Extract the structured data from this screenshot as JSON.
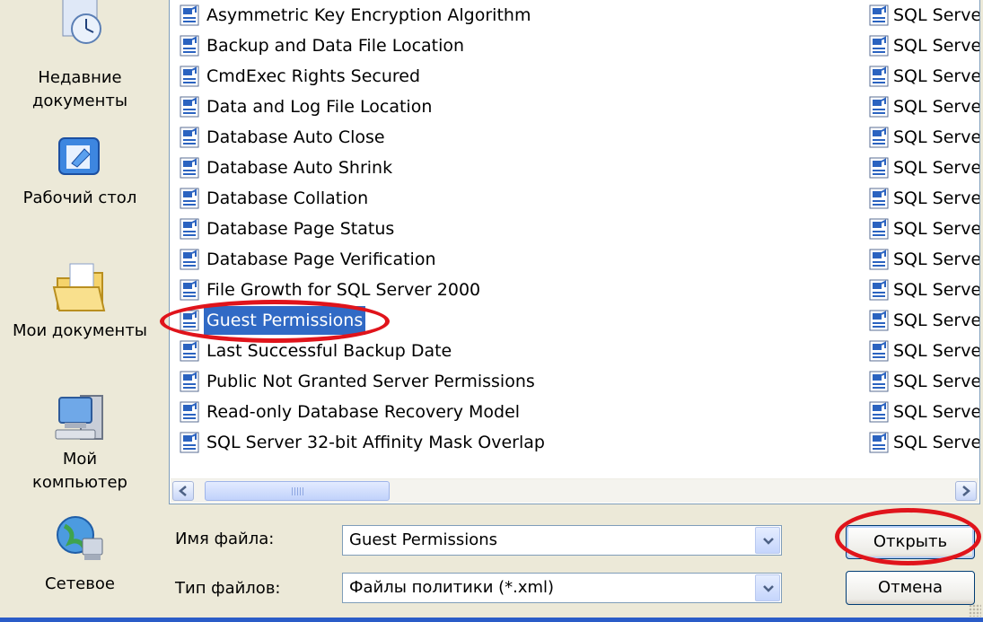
{
  "places": [
    {
      "label": "Недавние документы",
      "icon": "recent-documents-icon"
    },
    {
      "label": "Рабочий стол",
      "icon": "desktop-icon"
    },
    {
      "label": "Мои документы",
      "icon": "my-documents-icon"
    },
    {
      "label": "Мой компьютер",
      "icon": "my-computer-icon"
    },
    {
      "label": "Сетевое",
      "icon": "network-icon"
    }
  ],
  "files": [
    {
      "name": "Asymmetric Key Encryption Algorithm",
      "type": "SQL Serve"
    },
    {
      "name": "Backup and Data File Location",
      "type": "SQL Serve"
    },
    {
      "name": "CmdExec Rights Secured",
      "type": "SQL Serve"
    },
    {
      "name": "Data and Log File Location",
      "type": "SQL Serve"
    },
    {
      "name": "Database Auto Close",
      "type": "SQL Serve"
    },
    {
      "name": "Database Auto Shrink",
      "type": "SQL Serve"
    },
    {
      "name": "Database Collation",
      "type": "SQL Serve"
    },
    {
      "name": "Database Page Status",
      "type": "SQL Serve"
    },
    {
      "name": "Database Page Verification",
      "type": "SQL Serve"
    },
    {
      "name": "File Growth for SQL Server 2000",
      "type": "SQL Serve"
    },
    {
      "name": "Guest Permissions",
      "type": "SQL Serve",
      "selected": true
    },
    {
      "name": "Last Successful Backup Date",
      "type": "SQL Serve"
    },
    {
      "name": "Public Not Granted Server Permissions",
      "type": "SQL Serve"
    },
    {
      "name": "Read-only Database Recovery Model",
      "type": "SQL Serve"
    },
    {
      "name": "SQL Server 32-bit Affinity Mask Overlap",
      "type": "SQL Serve"
    }
  ],
  "filename": {
    "label": "Имя файла:",
    "value": "Guest Permissions"
  },
  "filetype": {
    "label": "Тип файлов:",
    "value": "Файлы политики (*.xml)"
  },
  "buttons": {
    "open": "Открыть",
    "cancel": "Отмена"
  },
  "colors": {
    "selection": "#316ac5",
    "highlight_ring": "#e0141b",
    "dialog_bg": "#ece9d8"
  }
}
